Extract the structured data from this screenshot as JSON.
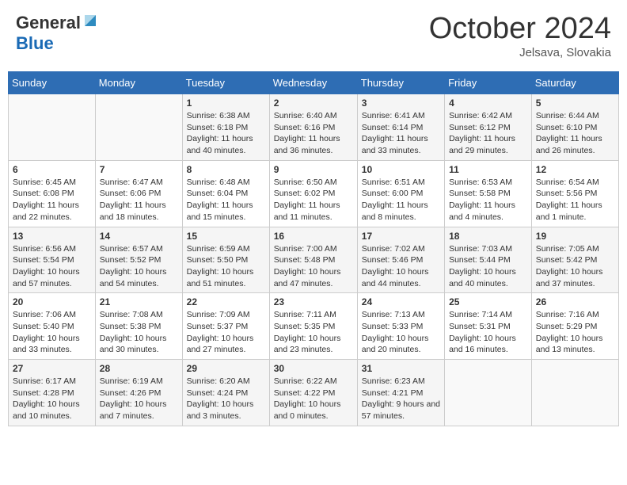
{
  "header": {
    "logo_general": "General",
    "logo_blue": "Blue",
    "month_title": "October 2024",
    "location": "Jelsava, Slovakia"
  },
  "days_of_week": [
    "Sunday",
    "Monday",
    "Tuesday",
    "Wednesday",
    "Thursday",
    "Friday",
    "Saturday"
  ],
  "weeks": [
    [
      {
        "day": "",
        "info": ""
      },
      {
        "day": "",
        "info": ""
      },
      {
        "day": "1",
        "sunrise": "Sunrise: 6:38 AM",
        "sunset": "Sunset: 6:18 PM",
        "daylight": "Daylight: 11 hours and 40 minutes."
      },
      {
        "day": "2",
        "sunrise": "Sunrise: 6:40 AM",
        "sunset": "Sunset: 6:16 PM",
        "daylight": "Daylight: 11 hours and 36 minutes."
      },
      {
        "day": "3",
        "sunrise": "Sunrise: 6:41 AM",
        "sunset": "Sunset: 6:14 PM",
        "daylight": "Daylight: 11 hours and 33 minutes."
      },
      {
        "day": "4",
        "sunrise": "Sunrise: 6:42 AM",
        "sunset": "Sunset: 6:12 PM",
        "daylight": "Daylight: 11 hours and 29 minutes."
      },
      {
        "day": "5",
        "sunrise": "Sunrise: 6:44 AM",
        "sunset": "Sunset: 6:10 PM",
        "daylight": "Daylight: 11 hours and 26 minutes."
      }
    ],
    [
      {
        "day": "6",
        "sunrise": "Sunrise: 6:45 AM",
        "sunset": "Sunset: 6:08 PM",
        "daylight": "Daylight: 11 hours and 22 minutes."
      },
      {
        "day": "7",
        "sunrise": "Sunrise: 6:47 AM",
        "sunset": "Sunset: 6:06 PM",
        "daylight": "Daylight: 11 hours and 18 minutes."
      },
      {
        "day": "8",
        "sunrise": "Sunrise: 6:48 AM",
        "sunset": "Sunset: 6:04 PM",
        "daylight": "Daylight: 11 hours and 15 minutes."
      },
      {
        "day": "9",
        "sunrise": "Sunrise: 6:50 AM",
        "sunset": "Sunset: 6:02 PM",
        "daylight": "Daylight: 11 hours and 11 minutes."
      },
      {
        "day": "10",
        "sunrise": "Sunrise: 6:51 AM",
        "sunset": "Sunset: 6:00 PM",
        "daylight": "Daylight: 11 hours and 8 minutes."
      },
      {
        "day": "11",
        "sunrise": "Sunrise: 6:53 AM",
        "sunset": "Sunset: 5:58 PM",
        "daylight": "Daylight: 11 hours and 4 minutes."
      },
      {
        "day": "12",
        "sunrise": "Sunrise: 6:54 AM",
        "sunset": "Sunset: 5:56 PM",
        "daylight": "Daylight: 11 hours and 1 minute."
      }
    ],
    [
      {
        "day": "13",
        "sunrise": "Sunrise: 6:56 AM",
        "sunset": "Sunset: 5:54 PM",
        "daylight": "Daylight: 10 hours and 57 minutes."
      },
      {
        "day": "14",
        "sunrise": "Sunrise: 6:57 AM",
        "sunset": "Sunset: 5:52 PM",
        "daylight": "Daylight: 10 hours and 54 minutes."
      },
      {
        "day": "15",
        "sunrise": "Sunrise: 6:59 AM",
        "sunset": "Sunset: 5:50 PM",
        "daylight": "Daylight: 10 hours and 51 minutes."
      },
      {
        "day": "16",
        "sunrise": "Sunrise: 7:00 AM",
        "sunset": "Sunset: 5:48 PM",
        "daylight": "Daylight: 10 hours and 47 minutes."
      },
      {
        "day": "17",
        "sunrise": "Sunrise: 7:02 AM",
        "sunset": "Sunset: 5:46 PM",
        "daylight": "Daylight: 10 hours and 44 minutes."
      },
      {
        "day": "18",
        "sunrise": "Sunrise: 7:03 AM",
        "sunset": "Sunset: 5:44 PM",
        "daylight": "Daylight: 10 hours and 40 minutes."
      },
      {
        "day": "19",
        "sunrise": "Sunrise: 7:05 AM",
        "sunset": "Sunset: 5:42 PM",
        "daylight": "Daylight: 10 hours and 37 minutes."
      }
    ],
    [
      {
        "day": "20",
        "sunrise": "Sunrise: 7:06 AM",
        "sunset": "Sunset: 5:40 PM",
        "daylight": "Daylight: 10 hours and 33 minutes."
      },
      {
        "day": "21",
        "sunrise": "Sunrise: 7:08 AM",
        "sunset": "Sunset: 5:38 PM",
        "daylight": "Daylight: 10 hours and 30 minutes."
      },
      {
        "day": "22",
        "sunrise": "Sunrise: 7:09 AM",
        "sunset": "Sunset: 5:37 PM",
        "daylight": "Daylight: 10 hours and 27 minutes."
      },
      {
        "day": "23",
        "sunrise": "Sunrise: 7:11 AM",
        "sunset": "Sunset: 5:35 PM",
        "daylight": "Daylight: 10 hours and 23 minutes."
      },
      {
        "day": "24",
        "sunrise": "Sunrise: 7:13 AM",
        "sunset": "Sunset: 5:33 PM",
        "daylight": "Daylight: 10 hours and 20 minutes."
      },
      {
        "day": "25",
        "sunrise": "Sunrise: 7:14 AM",
        "sunset": "Sunset: 5:31 PM",
        "daylight": "Daylight: 10 hours and 16 minutes."
      },
      {
        "day": "26",
        "sunrise": "Sunrise: 7:16 AM",
        "sunset": "Sunset: 5:29 PM",
        "daylight": "Daylight: 10 hours and 13 minutes."
      }
    ],
    [
      {
        "day": "27",
        "sunrise": "Sunrise: 6:17 AM",
        "sunset": "Sunset: 4:28 PM",
        "daylight": "Daylight: 10 hours and 10 minutes."
      },
      {
        "day": "28",
        "sunrise": "Sunrise: 6:19 AM",
        "sunset": "Sunset: 4:26 PM",
        "daylight": "Daylight: 10 hours and 7 minutes."
      },
      {
        "day": "29",
        "sunrise": "Sunrise: 6:20 AM",
        "sunset": "Sunset: 4:24 PM",
        "daylight": "Daylight: 10 hours and 3 minutes."
      },
      {
        "day": "30",
        "sunrise": "Sunrise: 6:22 AM",
        "sunset": "Sunset: 4:22 PM",
        "daylight": "Daylight: 10 hours and 0 minutes."
      },
      {
        "day": "31",
        "sunrise": "Sunrise: 6:23 AM",
        "sunset": "Sunset: 4:21 PM",
        "daylight": "Daylight: 9 hours and 57 minutes."
      },
      {
        "day": "",
        "info": ""
      },
      {
        "day": "",
        "info": ""
      }
    ]
  ]
}
